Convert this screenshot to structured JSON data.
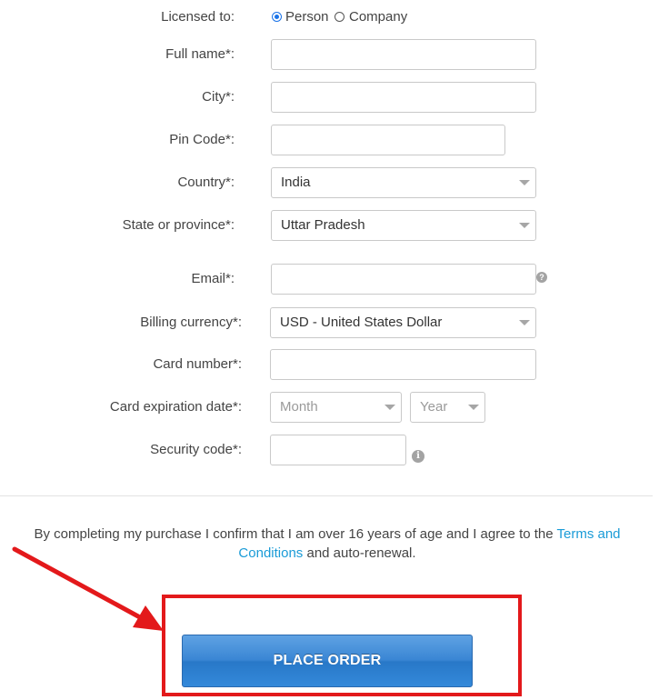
{
  "form": {
    "licensed_to": {
      "label": "Licensed to:",
      "options": [
        {
          "label": "Person",
          "checked": true
        },
        {
          "label": "Company",
          "checked": false
        }
      ]
    },
    "full_name": {
      "label": "Full name*:",
      "value": ""
    },
    "city": {
      "label": "City*:",
      "value": ""
    },
    "pin_code": {
      "label": "Pin Code*:",
      "value": ""
    },
    "country": {
      "label": "Country*:",
      "selected": "India"
    },
    "state": {
      "label": "State or province*:",
      "selected": "Uttar Pradesh"
    },
    "email": {
      "label": "Email*:",
      "value": "",
      "help_glyph": "?"
    },
    "billing_currency": {
      "label": "Billing currency*:",
      "selected": "USD - United States Dollar"
    },
    "card_number": {
      "label": "Card number*:",
      "value": ""
    },
    "card_expiration": {
      "label": "Card expiration date*:",
      "month_placeholder": "Month",
      "year_placeholder": "Year"
    },
    "security_code": {
      "label": "Security code*:",
      "value": "",
      "info_glyph": "i"
    }
  },
  "terms": {
    "text_before": "By completing my purchase I confirm that I am over 16 years of age and I agree to the ",
    "link_text": "Terms and Conditions",
    "text_after": " and auto-renewal."
  },
  "place_order": {
    "label": "PLACE ORDER"
  },
  "colors": {
    "annotation_red": "#e3191b",
    "link": "#1a9bd7",
    "button_blue": "#3a86d4",
    "radio_selected": "#1a73e8"
  },
  "icons": [
    "radio-icon",
    "help-icon",
    "info-icon",
    "chevron-down-icon",
    "red-arrow-icon"
  ]
}
